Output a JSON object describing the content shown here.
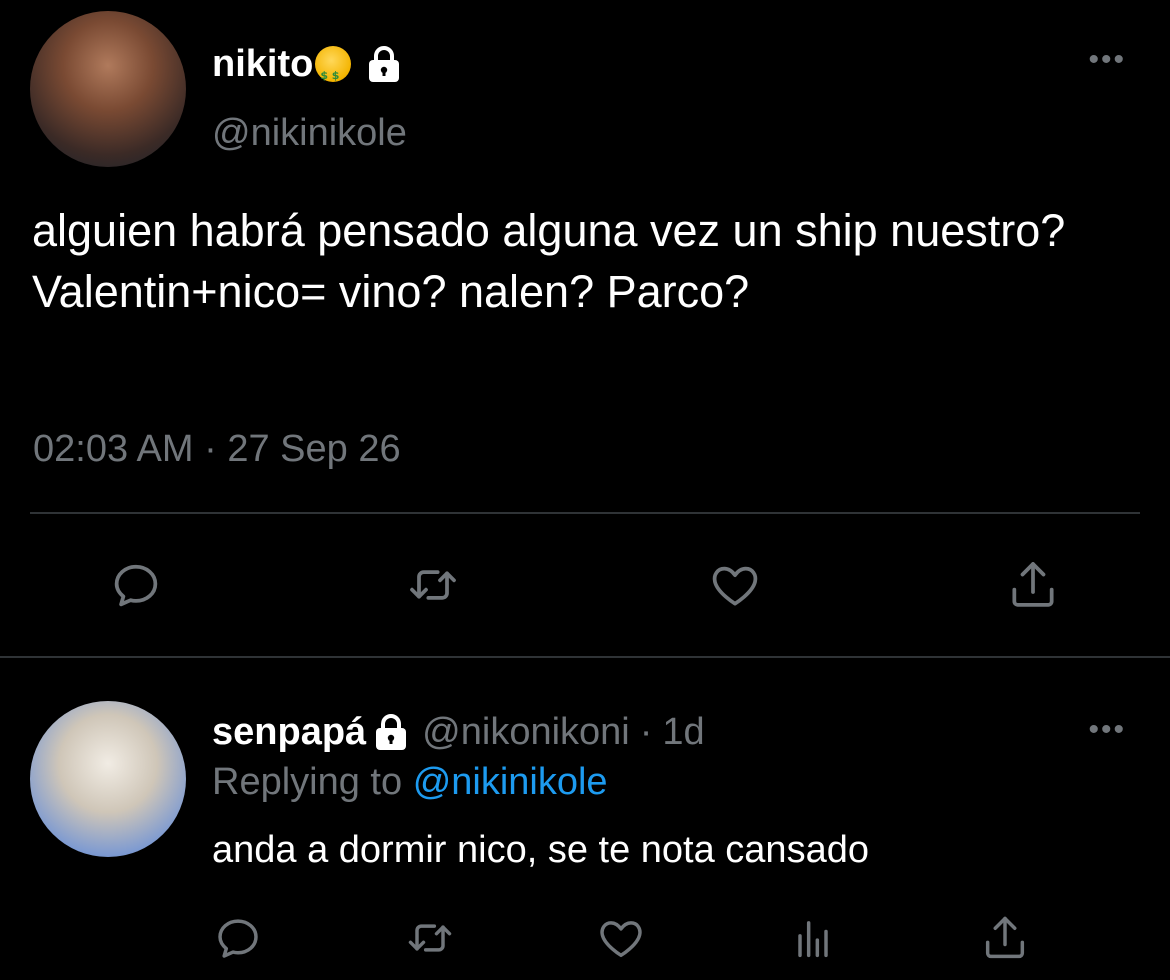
{
  "main_tweet": {
    "display_name": "nikito",
    "name_emoji": "money-mouth-face-emoji",
    "handle": "@nikinikole",
    "text": "alguien habrá pensado alguna vez un ship nuestro? Valentin+nico= vino? nalen? Parco?",
    "timestamp": "02:03 AM · 27 Sep 26",
    "more_label": "•••",
    "actions": [
      "reply-icon",
      "retweet-icon",
      "like-icon",
      "share-icon"
    ]
  },
  "reply_tweet": {
    "display_name": "senpapá",
    "handle": "@nikonikoni",
    "separator": "·",
    "age": "1d",
    "replying_prefix": "Replying to",
    "replying_mention": "@nikinikole",
    "text": "anda a dormir nico, se te nota cansado",
    "more_label": "•••",
    "actions": [
      "reply-icon",
      "retweet-icon",
      "like-icon",
      "stats-icon",
      "share-icon"
    ]
  },
  "colors": {
    "background": "#000000",
    "primary_text": "#ffffff",
    "secondary_text": "#71767b",
    "link": "#1d9bf0",
    "divider": "#2f3336"
  }
}
